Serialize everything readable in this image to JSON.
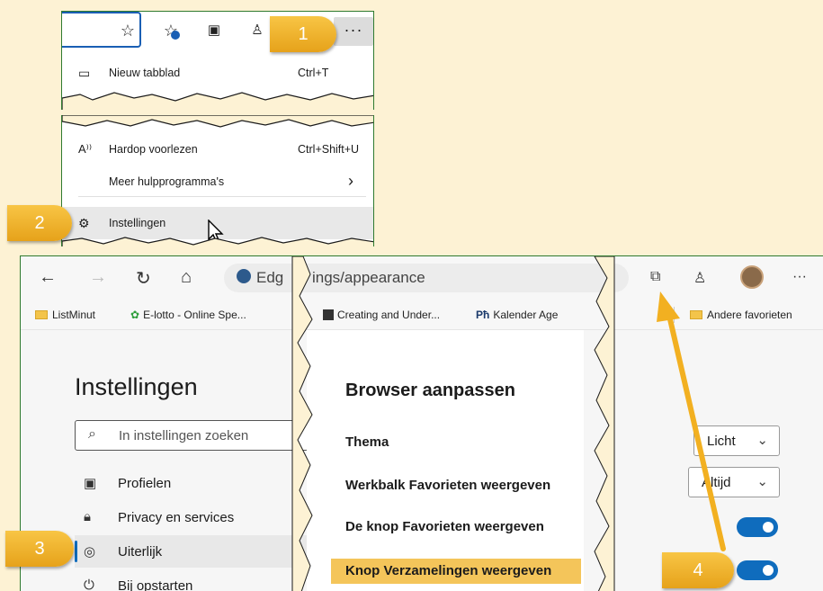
{
  "menu_top": {
    "items": [
      {
        "icon": "new-tab-icon",
        "label": "Nieuw tabblad",
        "shortcut": "Ctrl+T"
      }
    ]
  },
  "menu_bottom": {
    "items": [
      {
        "icon": "read-aloud-icon",
        "icon_glyph": "A⁾⁾",
        "label": "Hardop voorlezen",
        "shortcut": "Ctrl+Shift+U"
      },
      {
        "label": "Meer hulpprogramma's",
        "chevron": "›"
      },
      {
        "icon": "gear-icon",
        "label": "Instellingen"
      }
    ],
    "more_glyph": "···"
  },
  "browser": {
    "url": "ings/appearance",
    "url_prefix": "Edg",
    "favorites": [
      {
        "label": "ListMinut",
        "kind": "folder"
      },
      {
        "label": "E-lotto - Online Spe...",
        "kind": "link"
      },
      {
        "label": "Creating and Under...",
        "kind": "link"
      },
      {
        "label": "Kalender Age",
        "kind": "link",
        "prefix": "Pħ"
      },
      {
        "label": "Andere favorieten",
        "kind": "folder"
      }
    ]
  },
  "settings": {
    "title": "Instellingen",
    "search_placeholder": "In instellingen zoeken",
    "nav": [
      {
        "icon": "profile-icon",
        "label": "Profielen"
      },
      {
        "icon": "lock-icon",
        "label": "Privacy en services"
      },
      {
        "icon": "palette-icon",
        "label": "Uiterlijk",
        "active": true
      },
      {
        "icon": "power-icon",
        "label": "Bij opstarten"
      }
    ],
    "section_title": "Browser aanpassen",
    "options": [
      {
        "label": "Thema",
        "control": "dropdown",
        "value": "Licht"
      },
      {
        "label": "Werkbalk Favorieten weergeven",
        "control": "dropdown",
        "value": "Altijd"
      },
      {
        "label": "De knop Favorieten weergeven",
        "control": "toggle",
        "on": true
      },
      {
        "label": "Knop Verzamelingen weergeven",
        "control": "toggle",
        "on": true,
        "highlighted": true
      }
    ]
  },
  "callouts": [
    "1",
    "2",
    "3",
    "4"
  ],
  "colors": {
    "background": "#fdf2d4",
    "badge": "#f0b429",
    "accent": "#0f6cbd",
    "highlight": "#f4c55a",
    "frame": "#2f7a2f"
  }
}
